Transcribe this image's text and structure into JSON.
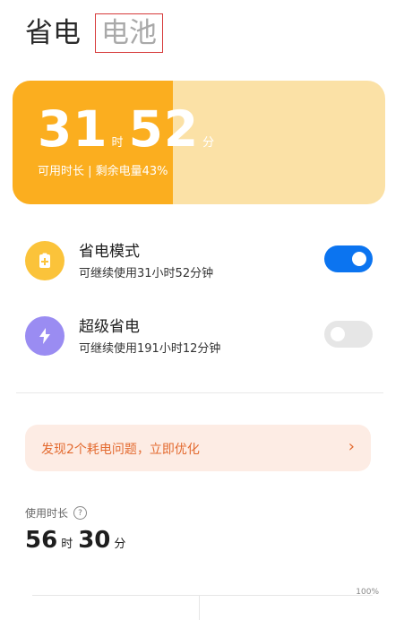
{
  "tabs": {
    "active": "省电",
    "inactive": "电池"
  },
  "battery_card": {
    "hours": "31",
    "hours_unit": "时",
    "minutes": "52",
    "minutes_unit": "分",
    "subtitle": "可用时长 | 剩余电量43%",
    "fill_fraction": 0.43,
    "fill_color": "#fbae1f",
    "bg_color": "#fbe1a6"
  },
  "modes": [
    {
      "title": "省电模式",
      "desc": "可继续使用31小时52分钟",
      "icon": "battery-plus-icon",
      "icon_color": "#fbc33a",
      "enabled": true
    },
    {
      "title": "超级省电",
      "desc": "可继续使用191小时12分钟",
      "icon": "lightning-icon",
      "icon_color": "#9a8cf2",
      "enabled": false
    }
  ],
  "issue_banner": {
    "text": "发现2个耗电问题，立即优化",
    "chevron": "›"
  },
  "usage": {
    "label": "使用时长",
    "help": "?",
    "hours": "56",
    "hours_unit": "时",
    "minutes": "30",
    "minutes_unit": "分"
  },
  "chart": {
    "right_label": "100%"
  },
  "colors": {
    "toggle_on": "#0b74f0",
    "toggle_off": "#e6e6e6",
    "accent_orange": "#e36a2f"
  }
}
